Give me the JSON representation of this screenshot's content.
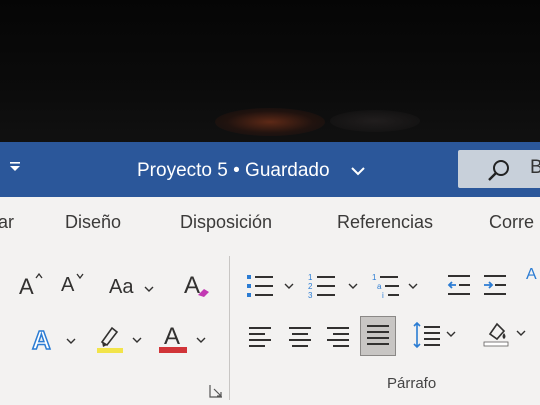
{
  "window": {
    "title": "Proyecto 5 • Guardado",
    "search_partial": "B"
  },
  "tabs": [
    {
      "label": "ar"
    },
    {
      "label": "Diseño"
    },
    {
      "label": "Disposición"
    },
    {
      "label": "Referencias"
    },
    {
      "label": "Corre"
    }
  ],
  "font_group": {
    "grow_font": "A",
    "shrink_font": "A",
    "change_case": "Aa",
    "clear_formatting": "A",
    "text_effects": "A",
    "font_color": "A"
  },
  "paragraph_group": {
    "label": "Párrafo",
    "sort_partial": "A"
  },
  "colors": {
    "titlebar": "#2b579a",
    "highlight": "#f2e44a",
    "font_color_bar": "#d13438",
    "icon_blue": "#2b7cd3"
  }
}
